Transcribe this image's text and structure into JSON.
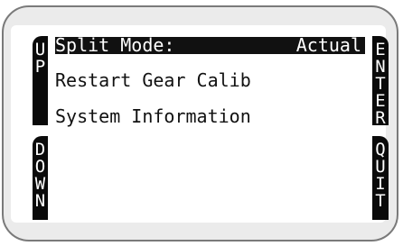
{
  "softkeys": {
    "up": [
      "U",
      "P"
    ],
    "down": [
      "D",
      "O",
      "W",
      "N"
    ],
    "enter": [
      "E",
      "N",
      "T",
      "E",
      "R"
    ],
    "quit": [
      "Q",
      "U",
      "I",
      "T"
    ]
  },
  "menu": {
    "items": [
      {
        "label": "Split Mode:",
        "value": "Actual",
        "selected": true
      },
      {
        "label": "Restart Gear Calib"
      },
      {
        "label": "System Information"
      }
    ]
  },
  "colors": {
    "key_bg": "#0a0a0a",
    "highlight_bg": "#111111",
    "bezel": "#ebebeb"
  }
}
